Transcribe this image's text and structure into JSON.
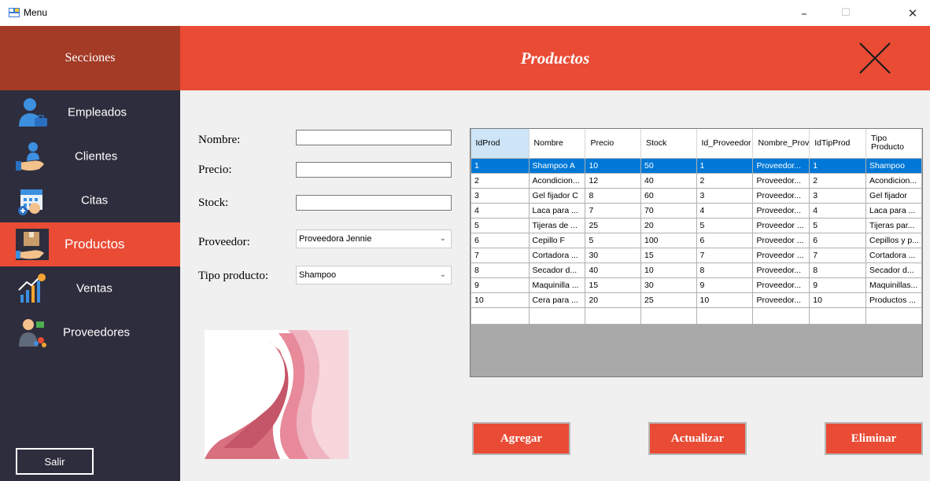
{
  "window": {
    "title": "Menu",
    "minimize": "–",
    "maximize": "☐",
    "close": "✕"
  },
  "sidebar": {
    "header": "Secciones",
    "items": [
      {
        "label": "Empleados",
        "icon": "employee-icon"
      },
      {
        "label": "Clientes",
        "icon": "client-icon"
      },
      {
        "label": "Citas",
        "icon": "calendar-icon"
      },
      {
        "label": "Productos",
        "icon": "product-icon",
        "active": true
      },
      {
        "label": "Ventas",
        "icon": "sales-chart-icon"
      },
      {
        "label": "Proveedores",
        "icon": "supplier-icon"
      }
    ],
    "exit_label": "Salir"
  },
  "header": {
    "title": "Productos"
  },
  "form": {
    "nombre_label": "Nombre:",
    "precio_label": "Precio:",
    "stock_label": "Stock:",
    "proveedor_label": "Proveedor:",
    "tipo_label": "Tipo producto:",
    "nombre_value": "",
    "precio_value": "",
    "stock_value": "",
    "proveedor_value": "Proveedora Jennie",
    "tipo_value": "Shampoo"
  },
  "grid": {
    "columns": [
      "IdProd",
      "Nombre",
      "Precio",
      "Stock",
      "Id_Proveedor",
      "Nombre_Prov",
      "IdTipProd",
      "Tipo Producto"
    ],
    "rows": [
      [
        "1",
        "Shampoo A",
        "10",
        "50",
        "1",
        "Proveedor...",
        "1",
        "Shampoo"
      ],
      [
        "2",
        "Acondicion...",
        "12",
        "40",
        "2",
        "Proveedor...",
        "2",
        "Acondicion..."
      ],
      [
        "3",
        "Gel fijador C",
        "8",
        "60",
        "3",
        "Proveedor...",
        "3",
        "Gel fijador"
      ],
      [
        "4",
        "Laca para ...",
        "7",
        "70",
        "4",
        "Proveedor...",
        "4",
        "Laca para ..."
      ],
      [
        "5",
        "Tijeras de ...",
        "25",
        "20",
        "5",
        "Proveedor ...",
        "5",
        "Tijeras par..."
      ],
      [
        "6",
        "Cepillo F",
        "5",
        "100",
        "6",
        "Proveedor ...",
        "6",
        "Cepillos y p..."
      ],
      [
        "7",
        "Cortadora ...",
        "30",
        "15",
        "7",
        "Proveedor ...",
        "7",
        "Cortadora ..."
      ],
      [
        "8",
        "Secador d...",
        "40",
        "10",
        "8",
        "Proveedor...",
        "8",
        "Secador d..."
      ],
      [
        "9",
        "Maquinilla ...",
        "15",
        "30",
        "9",
        "Proveedor...",
        "9",
        "Maquinillas..."
      ],
      [
        "10",
        "Cera para ...",
        "20",
        "25",
        "10",
        "Proveedor...",
        "10",
        "Productos ..."
      ]
    ],
    "selected_row": 0
  },
  "actions": {
    "add": "Agregar",
    "update": "Actualizar",
    "delete": "Eliminar"
  },
  "colors": {
    "accent": "#e94b35",
    "sidebar": "#2e2d3d",
    "sidebar_header": "#a33b27",
    "selection": "#0078d7"
  }
}
